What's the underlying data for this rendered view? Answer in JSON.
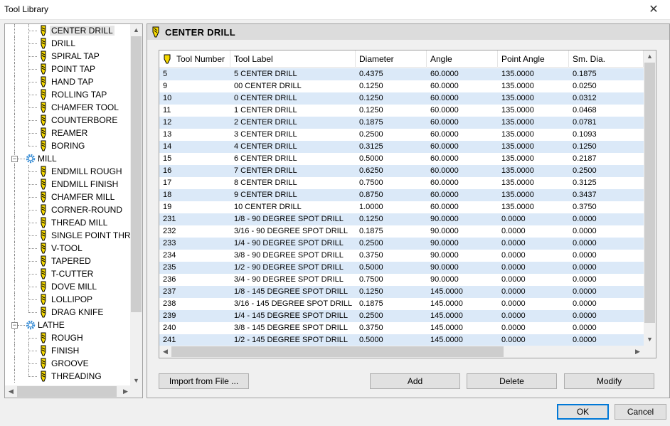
{
  "window": {
    "title": "Tool Library",
    "close_glyph": "✕"
  },
  "tree": {
    "items": [
      {
        "label": "CENTER DRILL",
        "icon": "center-drill-icon",
        "level": 2,
        "selected": true
      },
      {
        "label": "DRILL",
        "icon": "drill-icon",
        "level": 2
      },
      {
        "label": "SPIRAL TAP",
        "icon": "spiral-tap-icon",
        "level": 2
      },
      {
        "label": "POINT TAP",
        "icon": "point-tap-icon",
        "level": 2
      },
      {
        "label": "HAND TAP",
        "icon": "hand-tap-icon",
        "level": 2
      },
      {
        "label": "ROLLING TAP",
        "icon": "rolling-tap-icon",
        "level": 2
      },
      {
        "label": "CHAMFER TOOL",
        "icon": "chamfer-tool-icon",
        "level": 2
      },
      {
        "label": "COUNTERBORE",
        "icon": "counterbore-icon",
        "level": 2
      },
      {
        "label": "REAMER",
        "icon": "reamer-icon",
        "level": 2
      },
      {
        "label": "BORING",
        "icon": "boring-icon",
        "level": 2
      },
      {
        "label": "MILL",
        "icon": "gear-icon",
        "level": 1,
        "expander": "−"
      },
      {
        "label": "ENDMILL ROUGH",
        "icon": "endmill-rough-icon",
        "level": 2
      },
      {
        "label": "ENDMILL FINISH",
        "icon": "endmill-finish-icon",
        "level": 2
      },
      {
        "label": "CHAMFER MILL",
        "icon": "chamfer-mill-icon",
        "level": 2
      },
      {
        "label": "CORNER-ROUND",
        "icon": "corner-round-icon",
        "level": 2
      },
      {
        "label": "THREAD MILL",
        "icon": "thread-mill-icon",
        "level": 2
      },
      {
        "label": "SINGLE POINT THREA",
        "icon": "single-point-thread-icon",
        "level": 2
      },
      {
        "label": "V-TOOL",
        "icon": "v-tool-icon",
        "level": 2
      },
      {
        "label": "TAPERED",
        "icon": "tapered-icon",
        "level": 2
      },
      {
        "label": "T-CUTTER",
        "icon": "t-cutter-icon",
        "level": 2
      },
      {
        "label": "DOVE MILL",
        "icon": "dove-mill-icon",
        "level": 2
      },
      {
        "label": "LOLLIPOP",
        "icon": "lollipop-icon",
        "level": 2
      },
      {
        "label": "DRAG KNIFE",
        "icon": "drag-knife-icon",
        "level": 2
      },
      {
        "label": "LATHE",
        "icon": "gear-icon",
        "level": 1,
        "expander": "−"
      },
      {
        "label": "ROUGH",
        "icon": "lathe-rough-icon",
        "level": 2
      },
      {
        "label": "FINISH",
        "icon": "lathe-finish-icon",
        "level": 2
      },
      {
        "label": "GROOVE",
        "icon": "groove-icon",
        "level": 2
      },
      {
        "label": "THREADING",
        "icon": "threading-icon",
        "level": 2
      }
    ]
  },
  "panel": {
    "title": "CENTER DRILL",
    "icon": "center-drill-icon"
  },
  "grid": {
    "columns": [
      "Tool Number",
      "Tool Label",
      "Diameter",
      "Angle",
      "Point Angle",
      "Sm. Dia."
    ],
    "rows": [
      [
        "5",
        "5 CENTER DRILL",
        "0.4375",
        "60.0000",
        "135.0000",
        "0.1875"
      ],
      [
        "9",
        "00 CENTER DRILL",
        "0.1250",
        "60.0000",
        "135.0000",
        "0.0250"
      ],
      [
        "10",
        "0 CENTER DRILL",
        "0.1250",
        "60.0000",
        "135.0000",
        "0.0312"
      ],
      [
        "11",
        "1 CENTER DRILL",
        "0.1250",
        "60.0000",
        "135.0000",
        "0.0468"
      ],
      [
        "12",
        "2 CENTER DRILL",
        "0.1875",
        "60.0000",
        "135.0000",
        "0.0781"
      ],
      [
        "13",
        "3 CENTER DRILL",
        "0.2500",
        "60.0000",
        "135.0000",
        "0.1093"
      ],
      [
        "14",
        "4 CENTER DRILL",
        "0.3125",
        "60.0000",
        "135.0000",
        "0.1250"
      ],
      [
        "15",
        "6 CENTER DRILL",
        "0.5000",
        "60.0000",
        "135.0000",
        "0.2187"
      ],
      [
        "16",
        "7 CENTER DRILL",
        "0.6250",
        "60.0000",
        "135.0000",
        "0.2500"
      ],
      [
        "17",
        "8 CENTER DRILL",
        "0.7500",
        "60.0000",
        "135.0000",
        "0.3125"
      ],
      [
        "18",
        "9 CENTER DRILL",
        "0.8750",
        "60.0000",
        "135.0000",
        "0.3437"
      ],
      [
        "19",
        "10 CENTER DRILL",
        "1.0000",
        "60.0000",
        "135.0000",
        "0.3750"
      ],
      [
        "231",
        "1/8 - 90 DEGREE SPOT DRILL",
        "0.1250",
        "90.0000",
        "0.0000",
        "0.0000"
      ],
      [
        "232",
        "3/16 - 90 DEGREE SPOT DRILL",
        "0.1875",
        "90.0000",
        "0.0000",
        "0.0000"
      ],
      [
        "233",
        "1/4 - 90 DEGREE SPOT DRILL",
        "0.2500",
        "90.0000",
        "0.0000",
        "0.0000"
      ],
      [
        "234",
        "3/8 - 90 DEGREE SPOT DRILL",
        "0.3750",
        "90.0000",
        "0.0000",
        "0.0000"
      ],
      [
        "235",
        "1/2 - 90 DEGREE SPOT DRILL",
        "0.5000",
        "90.0000",
        "0.0000",
        "0.0000"
      ],
      [
        "236",
        "3/4 - 90 DEGREE SPOT DRILL",
        "0.7500",
        "90.0000",
        "0.0000",
        "0.0000"
      ],
      [
        "237",
        "1/8 - 145 DEGREE SPOT DRILL",
        "0.1250",
        "145.0000",
        "0.0000",
        "0.0000"
      ],
      [
        "238",
        "3/16 - 145 DEGREE SPOT DRILL",
        "0.1875",
        "145.0000",
        "0.0000",
        "0.0000"
      ],
      [
        "239",
        "1/4 - 145 DEGREE SPOT DRILL",
        "0.2500",
        "145.0000",
        "0.0000",
        "0.0000"
      ],
      [
        "240",
        "3/8 - 145 DEGREE SPOT DRILL",
        "0.3750",
        "145.0000",
        "0.0000",
        "0.0000"
      ],
      [
        "241",
        "1/2 - 145 DEGREE SPOT DRILL",
        "0.5000",
        "145.0000",
        "0.0000",
        "0.0000"
      ]
    ]
  },
  "buttons": {
    "import": "Import from File ...",
    "add": "Add",
    "delete": "Delete",
    "modify": "Modify",
    "ok": "OK",
    "cancel": "Cancel"
  },
  "colors": {
    "row_alt": "#dbe9f8",
    "tool_yellow": "#f5d800",
    "gear_blue": "#3c8fd6",
    "default_button_border": "#0078d7"
  }
}
